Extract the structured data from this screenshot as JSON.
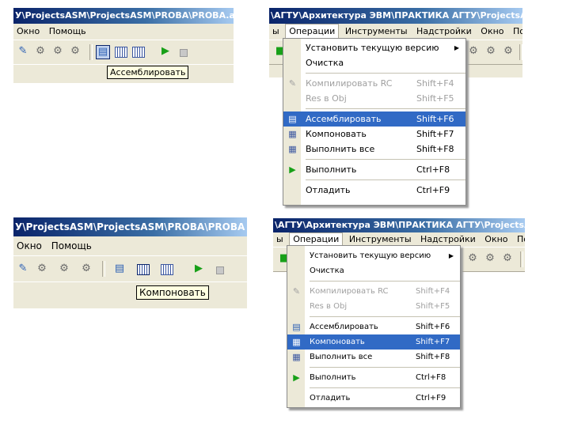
{
  "panel1": {
    "title": "У\\ProjectsASM\\ProjectsASM\\PROBA\\PROBA.asm",
    "menus": [
      "Окно",
      "Помощь"
    ],
    "tooltip": "Ассемблировать"
  },
  "panel2": {
    "title": "\\АГТУ\\Архитектура ЭВМ\\ПРАКТИКА АГТУ\\ProjectsASM\\Projects",
    "menus": [
      "ы",
      "Операции",
      "Инструменты",
      "Надстройки",
      "Окно",
      "Помощь"
    ],
    "items": [
      {
        "label": "Установить текущую версию",
        "shortcut": ""
      },
      {
        "label": "Очистка",
        "shortcut": ""
      },
      {
        "label": "Компилировать RC",
        "shortcut": "Shift+F4"
      },
      {
        "label": "Res в Obj",
        "shortcut": "Shift+F5"
      },
      {
        "label": "Ассемблировать",
        "shortcut": "Shift+F6"
      },
      {
        "label": "Компоновать",
        "shortcut": "Shift+F7"
      },
      {
        "label": "Выполнить все",
        "shortcut": "Shift+F8"
      },
      {
        "label": "Выполнить",
        "shortcut": "Ctrl+F8"
      },
      {
        "label": "Отладить",
        "shortcut": "Ctrl+F9"
      }
    ]
  },
  "panel3": {
    "title": "У\\ProjectsASM\\ProjectsASM\\PROBA\\PROBA",
    "menus": [
      "Окно",
      "Помощь"
    ],
    "tooltip": "Компоновать"
  },
  "panel4": {
    "title": "\\АГТУ\\Архитектура ЭВМ\\ПРАКТИКА АГТУ\\ProjectsASM\\Projects",
    "menus": [
      "ы",
      "Операции",
      "Инструменты",
      "Надстройки",
      "Окно",
      "Помощь"
    ],
    "items": [
      {
        "label": "Установить текущую версию",
        "shortcut": ""
      },
      {
        "label": "Очистка",
        "shortcut": ""
      },
      {
        "label": "Компилировать RC",
        "shortcut": "Shift+F4"
      },
      {
        "label": "Res в Obj",
        "shortcut": "Shift+F5"
      },
      {
        "label": "Ассемблировать",
        "shortcut": "Shift+F6"
      },
      {
        "label": "Компоновать",
        "shortcut": "Shift+F7"
      },
      {
        "label": "Выполнить все",
        "shortcut": "Shift+F8"
      },
      {
        "label": "Выполнить",
        "shortcut": "Ctrl+F8"
      },
      {
        "label": "Отладить",
        "shortcut": "Ctrl+F9"
      }
    ]
  },
  "icons": {
    "assemble": "assemble-icon",
    "link": "link-icon",
    "build_all": "build-all-icon",
    "run": "run-icon",
    "stop": "stop-icon",
    "compile_rc": "compile-rc-icon"
  },
  "colors": {
    "highlight": "#316ac5",
    "title_bar": "#0a246a",
    "tooltip_bg": "#ffffe1",
    "chrome": "#ece9d8"
  }
}
